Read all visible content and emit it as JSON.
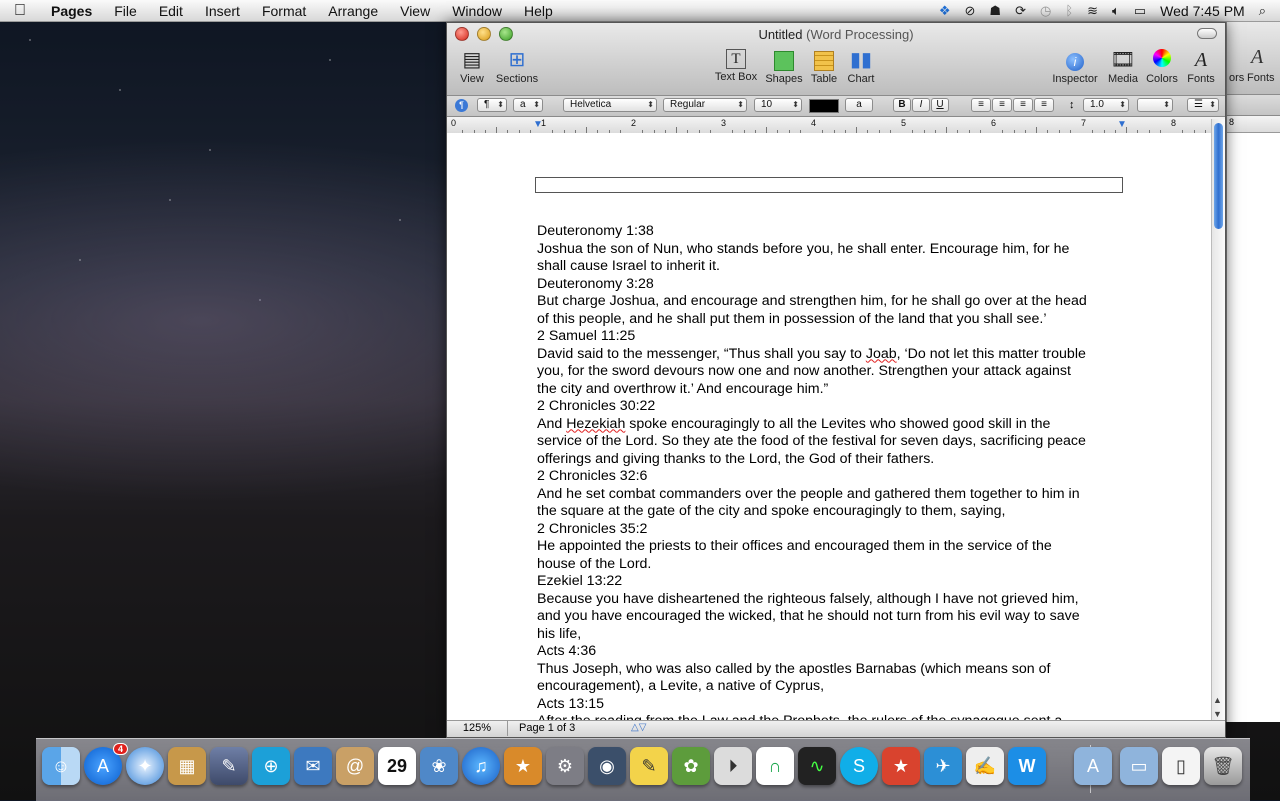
{
  "menubar": {
    "app_name": "Pages",
    "items": [
      "File",
      "Edit",
      "Insert",
      "Format",
      "Arrange",
      "View",
      "Window",
      "Help"
    ],
    "clock": "Wed 7:45 PM"
  },
  "window": {
    "title": "Untitled",
    "title_kind": "(Word Processing)",
    "toolbar": {
      "view": "View",
      "sections": "Sections",
      "text_box": "Text Box",
      "shapes": "Shapes",
      "table": "Table",
      "chart": "Chart",
      "inspector": "Inspector",
      "media": "Media",
      "colors": "Colors",
      "fonts": "Fonts"
    },
    "format_bar": {
      "paragraph_style": "¶",
      "char_style": "a",
      "font_family": "Helvetica",
      "font_typeface": "Regular",
      "font_size": "10",
      "text_bg_label": "a",
      "bold": "B",
      "italic": "I",
      "underline": "U",
      "line_spacing": "1.0"
    },
    "ruler_numbers": [
      "0",
      "1",
      "2",
      "3",
      "4",
      "5",
      "6",
      "7",
      "8"
    ],
    "status": {
      "zoom": "125%",
      "page": "Page 1 of 3"
    }
  },
  "document": {
    "lines": [
      "Deuteronomy 1:38",
      "Joshua the son of Nun, who stands before you, he shall enter. Encourage him, for he",
      "shall cause Israel to inherit it.",
      "Deuteronomy 3:28",
      "But charge Joshua, and encourage and strengthen him, for he shall go over at the head",
      "of this people, and he shall put them in possession of the land that you shall see.’",
      "2 Samuel 11:25",
      "David said to the messenger, “Thus shall you say to Joab, ‘Do not let this matter trouble",
      "you, for the sword devours now one and now another. Strengthen your attack against",
      "the city and overthrow it.’ And encourage him.”",
      "2 Chronicles 30:22",
      "And Hezekiah spoke encouragingly to all the Levites who showed good skill in the",
      "service of the Lord. So they ate the food of the festival for seven days, sacrificing peace",
      "offerings and giving thanks to the Lord, the God of their fathers.",
      "2 Chronicles 32:6",
      "And he set combat commanders over the people and gathered them together to him in",
      "the square at the gate of the city and spoke encouragingly to them, saying,",
      "2 Chronicles 35:2",
      "He appointed the priests to their offices and encouraged them in the service of the",
      "house of the Lord.",
      "Ezekiel 13:22",
      "Because you have disheartened the righteous falsely, although I have not grieved him,",
      "and you have encouraged the wicked, that he should not turn from his evil way to save",
      "his life,",
      "Acts 4:36",
      "Thus Joseph, who was also called by the apostles Barnabas (which means son of",
      "encouragement), a Levite, a native of Cyprus,",
      "Acts 13:15",
      "After the reading from the Law and the Prophets, the rulers of the synagogue sent a"
    ]
  },
  "sliver": {
    "label1": "ors",
    "label2": "Fonts",
    "ruler_number": "8"
  },
  "dock": {
    "calendar_day": "29",
    "appstore_badge": "4"
  },
  "colors": {
    "accent": "#2f6fd0",
    "misspell": "#e02020"
  }
}
